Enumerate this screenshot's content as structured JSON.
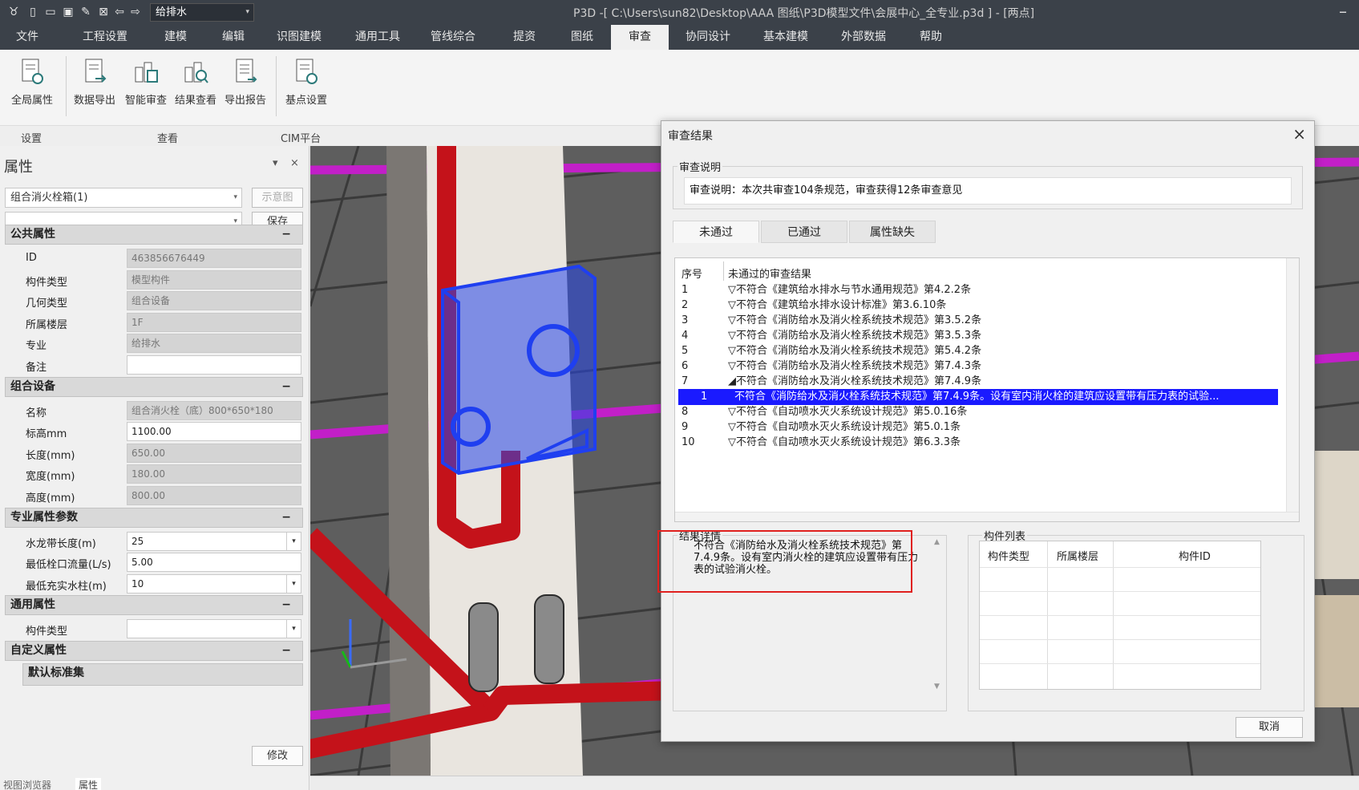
{
  "app": {
    "title": "P3D -[ C:\\Users\\sun82\\Desktop\\AAA 图纸\\P3D模型文件\\会展中心_全专业.p3d ] - [两点]",
    "discipline": "给排水"
  },
  "menu": [
    "文件",
    "工程设置",
    "建模",
    "编辑",
    "识图建模",
    "通用工具",
    "管线综合",
    "提资",
    "图纸",
    "审查",
    "协同设计",
    "基本建模",
    "外部数据",
    "帮助"
  ],
  "menu_active": "审查",
  "ribbon": {
    "buttons": [
      "全局属性",
      "数据导出",
      "智能审查",
      "结果查看",
      "导出报告",
      "基点设置"
    ],
    "groups": [
      "设置",
      "查看",
      "CIM平台"
    ]
  },
  "props": {
    "title": "属性",
    "pin": "▾",
    "close": "×",
    "component_select": "组合消火栓箱(1)",
    "preview_btn": "示意图",
    "save_btn": "保存",
    "modify_btn": "修改",
    "sections": {
      "public": {
        "label": "公共属性",
        "rows": [
          {
            "k": "ID",
            "v": "463856676449"
          },
          {
            "k": "构件类型",
            "v": "模型构件"
          },
          {
            "k": "几何类型",
            "v": "组合设备"
          },
          {
            "k": "所属楼层",
            "v": "1F"
          },
          {
            "k": "专业",
            "v": "给排水"
          },
          {
            "k": "备注",
            "v": ""
          }
        ]
      },
      "equipment": {
        "label": "组合设备",
        "rows": [
          {
            "k": "名称",
            "v": "组合消火栓（底）800*650*180"
          },
          {
            "k": "标高mm",
            "v": "1100.00"
          },
          {
            "k": "长度(mm)",
            "v": "650.00"
          },
          {
            "k": "宽度(mm)",
            "v": "180.00"
          },
          {
            "k": "高度(mm)",
            "v": "800.00"
          }
        ]
      },
      "professional": {
        "label": "专业属性参数",
        "rows": [
          {
            "k": "水龙带长度(m)",
            "v": "25"
          },
          {
            "k": "最低栓口流量(L/s)",
            "v": "5.00"
          },
          {
            "k": "最低充实水柱(m)",
            "v": "10"
          }
        ]
      },
      "general": {
        "label": "通用属性",
        "rows": [
          {
            "k": "构件类型",
            "v": ""
          }
        ]
      },
      "custom": {
        "label": "自定义属性",
        "default_set": "默认标准集"
      }
    },
    "bottom_tabs": [
      "视图浏览器",
      "属性"
    ]
  },
  "dialog": {
    "title": "审查结果",
    "close": "×",
    "desc_legend": "审查说明",
    "desc_text": "审查说明：本次共审查104条规范，审查获得12条审查意见",
    "tabs": [
      "未通过",
      "已通过",
      "属性缺失"
    ],
    "list_headers": [
      "序号",
      "未通过的审查结果"
    ],
    "results": [
      {
        "n": "1",
        "t": "▽不符合《建筑给水排水与节水通用规范》第4.2.2条"
      },
      {
        "n": "2",
        "t": "▽不符合《建筑给水排水设计标准》第3.6.10条"
      },
      {
        "n": "3",
        "t": "▽不符合《消防给水及消火栓系统技术规范》第3.5.2条"
      },
      {
        "n": "4",
        "t": "▽不符合《消防给水及消火栓系统技术规范》第3.5.3条"
      },
      {
        "n": "5",
        "t": "▽不符合《消防给水及消火栓系统技术规范》第5.4.2条"
      },
      {
        "n": "6",
        "t": "▽不符合《消防给水及消火栓系统技术规范》第7.4.3条"
      },
      {
        "n": "7",
        "t": "◢不符合《消防给水及消火栓系统技术规范》第7.4.9条"
      },
      {
        "n": "1",
        "t": "不符合《消防给水及消火栓系统技术规范》第7.4.9条。设有室内消火栓的建筑应设置带有压力表的试验...",
        "selected": true
      },
      {
        "n": "8",
        "t": "▽不符合《自动喷水灭火系统设计规范》第5.0.16条"
      },
      {
        "n": "9",
        "t": "▽不符合《自动喷水灭火系统设计规范》第5.0.1条"
      },
      {
        "n": "10",
        "t": "▽不符合《自动喷水灭火系统设计规范》第6.3.3条"
      }
    ],
    "detail_legend": "结果详情",
    "detail_text": "不符合《消防给水及消火栓系统技术规范》第7.4.9条。设有室内消火栓的建筑应设置带有压力表的试验消火栓。",
    "comp_legend": "构件列表",
    "comp_headers": [
      "构件类型",
      "所属楼层",
      "构件ID"
    ],
    "cancel": "取消"
  },
  "colors": {
    "titlebar": "#3b4149",
    "selection": "#1a1aff",
    "highlight_box": "#e0201e",
    "pipe_red": "#c4121a",
    "pipe_magenta": "#c21fc8",
    "cabinet_blue": "#1f3ff0"
  }
}
